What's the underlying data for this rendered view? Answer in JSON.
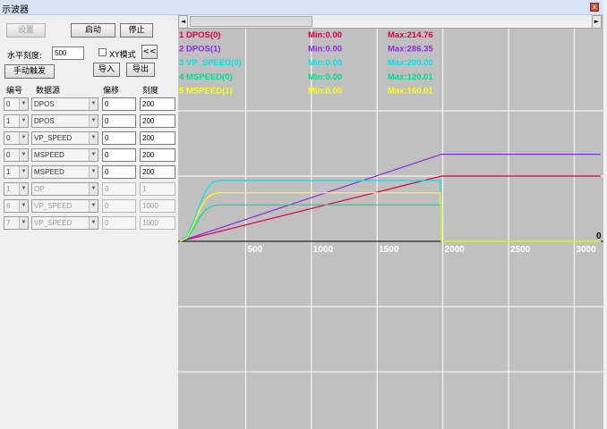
{
  "window": {
    "title": "示波器",
    "close_glyph": "x"
  },
  "toolbar": {
    "settings": "设置",
    "start": "启动",
    "stop": "停止"
  },
  "scale": {
    "label": "水平刻度:",
    "value": "500"
  },
  "xy_mode": {
    "label": "XY模式",
    "checked": false
  },
  "collapse": "<<",
  "manual_trigger": "手动触发",
  "import": "导入",
  "export": "导出",
  "headers": {
    "num": "编号",
    "source": "数据源",
    "offset": "偏移",
    "scale": "刻度"
  },
  "channels": [
    {
      "num": "0",
      "source": "DPOS",
      "offset": "0",
      "scale": "200",
      "enabled": true
    },
    {
      "num": "1",
      "source": "DPOS",
      "offset": "0",
      "scale": "200",
      "enabled": true
    },
    {
      "num": "0",
      "source": "VP_SPEED",
      "offset": "0",
      "scale": "200",
      "enabled": true
    },
    {
      "num": "0",
      "source": "MSPEED",
      "offset": "0",
      "scale": "200",
      "enabled": true
    },
    {
      "num": "1",
      "source": "MSPEED",
      "offset": "0",
      "scale": "200",
      "enabled": true
    },
    {
      "num": "1",
      "source": "OP",
      "offset": "0",
      "scale": "1",
      "enabled": false
    },
    {
      "num": "6",
      "source": "VP_SPEED",
      "offset": "0",
      "scale": "1000",
      "enabled": false
    },
    {
      "num": "7",
      "source": "VP_SPEED",
      "offset": "0",
      "scale": "1000",
      "enabled": false
    }
  ],
  "legend": [
    {
      "label": "1 DPOS(0)",
      "min": "Min:0.00",
      "max": "Max:214.76",
      "color": "#e0004c"
    },
    {
      "label": "2 DPOS(1)",
      "min": "Min:0.00",
      "max": "Max:286.35",
      "color": "#8a2be2"
    },
    {
      "label": "3 VP_SPEED(0)",
      "min": "Min:0.00",
      "max": "Max:200.00",
      "color": "#00e5e5"
    },
    {
      "label": "4 MSPEED(0)",
      "min": "Min:0.00",
      "max": "Max:120.01",
      "color": "#00dd88"
    },
    {
      "label": "5 MSPEED(1)",
      "min": "Min:0.00",
      "max": "Max:160.01",
      "color": "#ffff00"
    }
  ],
  "chart_data": {
    "type": "line",
    "x_ticks": [
      "500",
      "1000",
      "1500",
      "2000",
      "2500",
      "3000"
    ],
    "zero_label": "0",
    "xlim": [
      0,
      3200
    ],
    "grid": true,
    "series": [
      {
        "name": "1 DPOS(0)",
        "color": "#e0004c",
        "points": [
          [
            0,
            0
          ],
          [
            1990,
            214.76
          ],
          [
            3200,
            214.76
          ]
        ]
      },
      {
        "name": "2 DPOS(1)",
        "color": "#8a2be2",
        "points": [
          [
            0,
            0
          ],
          [
            1990,
            286.35
          ],
          [
            3200,
            286.35
          ]
        ]
      },
      {
        "name": "3 VP_SPEED(0)",
        "color": "#00e5e5",
        "points": [
          [
            0,
            0
          ],
          [
            50,
            15
          ],
          [
            100,
            60
          ],
          [
            150,
            120
          ],
          [
            200,
            170
          ],
          [
            250,
            195
          ],
          [
            300,
            200
          ],
          [
            1980,
            200
          ],
          [
            1990,
            0
          ],
          [
            3200,
            0
          ]
        ]
      },
      {
        "name": "4 MSPEED(0)",
        "color": "#00dd88",
        "points": [
          [
            0,
            0
          ],
          [
            50,
            8
          ],
          [
            100,
            40
          ],
          [
            150,
            80
          ],
          [
            200,
            105
          ],
          [
            250,
            117
          ],
          [
            300,
            120
          ],
          [
            1980,
            120
          ],
          [
            1990,
            0
          ],
          [
            3200,
            0
          ]
        ]
      },
      {
        "name": "5 MSPEED(1)",
        "color": "#ffff00",
        "points": [
          [
            0,
            0
          ],
          [
            50,
            10
          ],
          [
            100,
            50
          ],
          [
            150,
            105
          ],
          [
            200,
            140
          ],
          [
            250,
            156
          ],
          [
            300,
            160
          ],
          [
            1980,
            160
          ],
          [
            1990,
            0
          ],
          [
            3200,
            0
          ]
        ]
      }
    ]
  }
}
